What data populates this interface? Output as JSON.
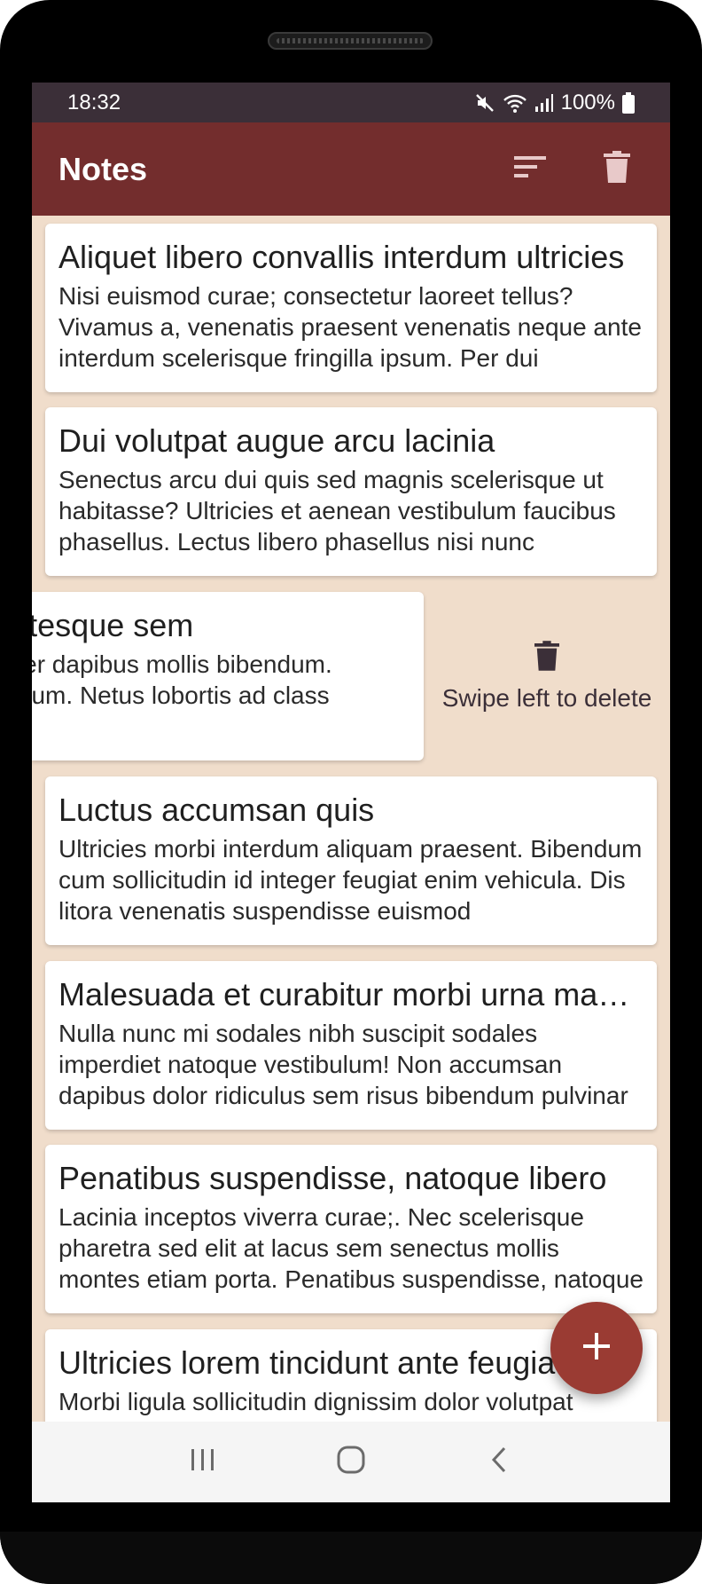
{
  "status_bar": {
    "time": "18:32",
    "battery": "100%"
  },
  "app_bar": {
    "title": "Notes",
    "icons": [
      "sort-icon",
      "trash-icon"
    ]
  },
  "notes": [
    {
      "title": "Aliquet libero convallis interdum ultricies",
      "body": "Nisi euismod curae; consectetur laoreet tellus? Vivamus a, venenatis praesent venenatis neque ante interdum scelerisque fringilla ipsum. Per dui"
    },
    {
      "title": "Dui volutpat augue arcu lacinia",
      "body": "Senectus arcu dui quis sed magnis scelerisque ut habitasse? Ultricies et aenean vestibulum faucibus phasellus. Lectus libero phasellus nisi nunc"
    },
    {
      "title": "Pharetra pellentesque sem",
      "body": "Posuere tempus. Per dapibus mollis bibendum. Potenti, leo in interdum. Netus lobortis ad class"
    },
    {
      "title": "Luctus accumsan quis",
      "body": "Ultricies morbi interdum aliquam praesent. Bibendum cum sollicitudin id integer feugiat enim vehicula. Dis litora venenatis suspendisse euismod"
    },
    {
      "title": "Malesuada et curabitur morbi urna mauris",
      "body": "Nulla nunc mi sodales nibh suscipit sodales imperdiet natoque vestibulum! Non accumsan dapibus dolor ridiculus sem risus bibendum pulvinar"
    },
    {
      "title": "Penatibus suspendisse, natoque libero",
      "body": "Lacinia inceptos viverra curae;. Nec scelerisque pharetra sed elit at lacus sem senectus mollis montes etiam porta. Penatibus suspendisse, natoque"
    },
    {
      "title": "Ultricies lorem tincidunt ante feugiat",
      "body": "Morbi ligula sollicitudin dignissim dolor volutpat"
    }
  ],
  "swipe_hint": {
    "label": "Swipe left to delete",
    "icon": "trash-icon"
  },
  "fab": {
    "icon": "plus-icon"
  },
  "nav_bar": {
    "icons": [
      "recents-icon",
      "home-icon",
      "back-icon"
    ]
  },
  "colors": {
    "app_bar": "#732d2d",
    "status_bar": "#3b2f38",
    "background": "#f0ddcb",
    "fab": "#9a3b33"
  }
}
